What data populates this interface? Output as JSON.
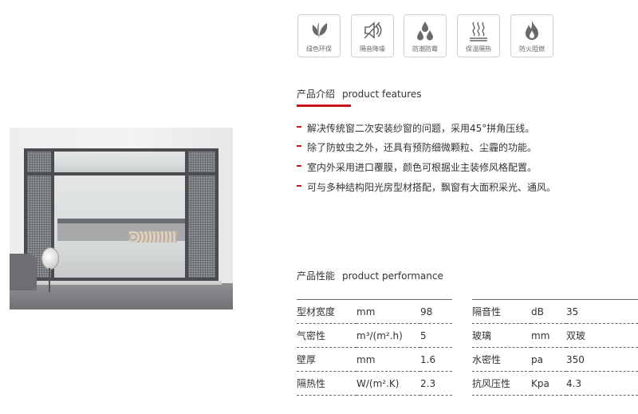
{
  "icons": [
    {
      "name": "leaf-icon",
      "label": "绿色环保"
    },
    {
      "name": "mute-icon",
      "label": "隔音降噪"
    },
    {
      "name": "drops-icon",
      "label": "防潮防霉"
    },
    {
      "name": "heat-icon",
      "label": "保温隔热"
    },
    {
      "name": "flame-icon",
      "label": "防火阻燃"
    }
  ],
  "features_section": {
    "title_cn": "产品介绍",
    "title_en": "product features",
    "items": [
      "解决传统窗二次安装纱窗的问题，采用45°拼角压线。",
      "除了防蚊虫之外，还具有预防细微颗粒、尘霾的功能。",
      "室内外采用进口覆膜，颜色可根据业主装修风格配置。",
      "可与多种结构阳光房型材搭配，飘窗有大面积采光、通风。"
    ]
  },
  "performance_section": {
    "title_cn": "产品性能",
    "title_en": "product performance",
    "left_table": [
      {
        "name": "型材宽度",
        "unit": "mm",
        "value": "98"
      },
      {
        "name": "气密性",
        "unit": "m³/(m².h)",
        "value": "5"
      },
      {
        "name": "壁厚",
        "unit": "mm",
        "value": "1.6"
      },
      {
        "name": "隔热性",
        "unit": "W/(m².K)",
        "value": "2.3"
      }
    ],
    "right_table": [
      {
        "name": "隔音性",
        "unit": "dB",
        "value": "35"
      },
      {
        "name": "玻璃",
        "unit": "mm",
        "value": "双玻"
      },
      {
        "name": "水密性",
        "unit": "pa",
        "value": "350"
      },
      {
        "name": "抗风压性",
        "unit": "Kpa",
        "value": "4.3"
      }
    ]
  },
  "colors": {
    "accent": "#c8161d",
    "frame": "#4a4c50"
  }
}
